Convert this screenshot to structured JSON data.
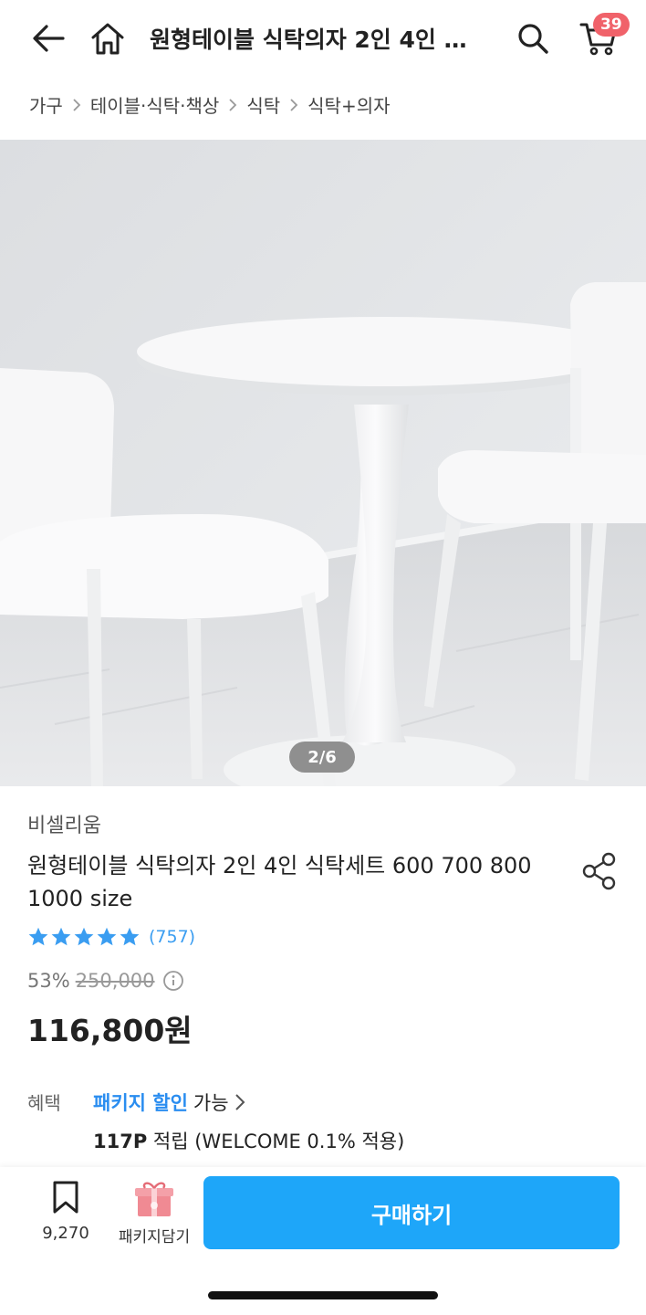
{
  "header": {
    "title": "원형테이블 식탁의자 2인 4인 식탁세트 600 700 800 1000 size",
    "cart_count": "39",
    "icons": [
      "back-arrow-icon",
      "home-icon",
      "search-icon",
      "cart-icon"
    ]
  },
  "breadcrumb": [
    "가구",
    "테이블·식탁·책상",
    "식탁",
    "식탁+의자"
  ],
  "image": {
    "counter": "2/6"
  },
  "product": {
    "brand": "비셀리움",
    "title": "원형테이블 식탁의자 2인 4인 식탁세트 600 700 800 1000 size",
    "rating": 5,
    "review_count": "(757)",
    "discount": "53%",
    "original_price": "250,000",
    "price": "116,800원"
  },
  "benefits": {
    "label": "혜택",
    "package_link": "패키지 할인",
    "package_available": "가능",
    "points_amount": "117P",
    "points_text": "적립 (WELCOME 0.1% 적용)"
  },
  "bottom_bar": {
    "wish_count": "9,270",
    "package_cart_label": "패키지담기",
    "buy_label": "구매하기"
  },
  "colors": {
    "accent": "#1ea6f9",
    "link": "#2a8df0",
    "star": "#3a9df1",
    "badge": "#f0626a"
  }
}
